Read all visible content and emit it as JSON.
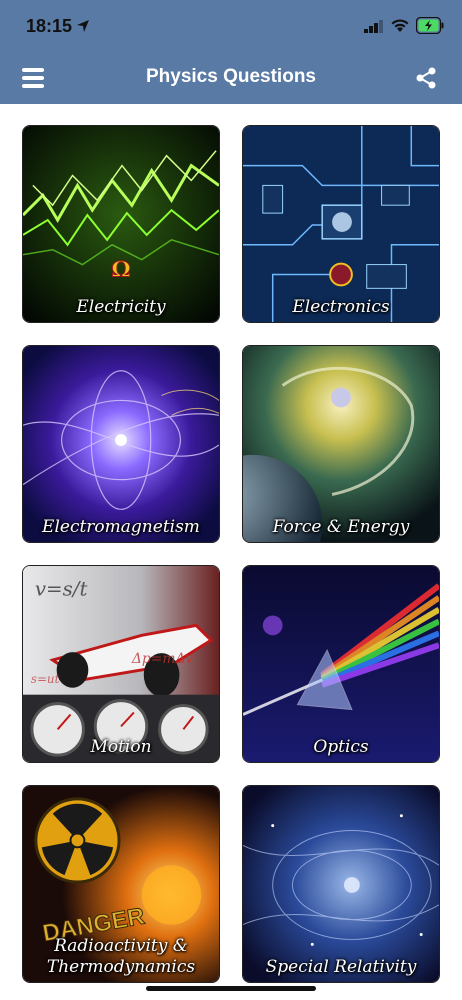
{
  "status_bar": {
    "time": "18:15"
  },
  "nav": {
    "title": "Physics Questions"
  },
  "tiles": [
    {
      "label": "Electricity"
    },
    {
      "label": "Electronics"
    },
    {
      "label": "Electromagnetism"
    },
    {
      "label": "Force & Energy"
    },
    {
      "label": "Motion",
      "overlay_1": "v=s/t",
      "overlay_2": "Δp=mΔv",
      "overlay_3": "s=ut"
    },
    {
      "label": "Optics"
    },
    {
      "label": "Radioactivity & Thermodynamics",
      "overlay_1": "DANGER"
    },
    {
      "label": "Special Relativity"
    }
  ],
  "colors": {
    "nav_bar": "#5a7aa6",
    "battery": "#4cd964"
  }
}
